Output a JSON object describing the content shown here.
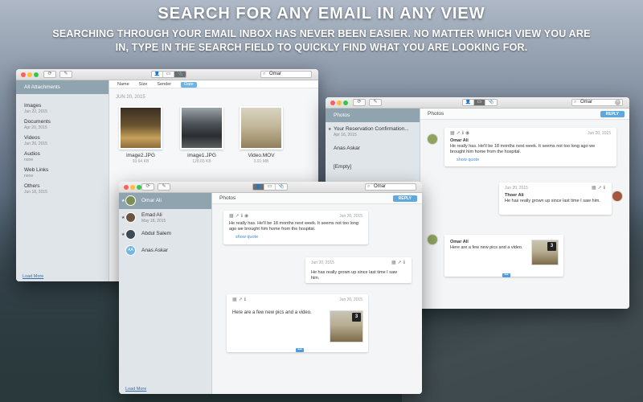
{
  "promo": {
    "headline": "SEARCH FOR ANY EMAIL IN ANY VIEW",
    "subline": "SEARCHING THROUGH YOUR EMAIL INBOX HAS NEVER BEEN EASIER. NO MATTER WHICH VIEW YOU ARE IN, TYPE IN THE SEARCH FIELD TO QUICKLY FIND WHAT YOU ARE LOOKING FOR."
  },
  "search_query": "Omar",
  "attachments_window": {
    "sidebar": {
      "items": [
        {
          "label": "All Attachments",
          "sub": ""
        },
        {
          "label": "Images",
          "sub": "Jun 22, 2015"
        },
        {
          "label": "Documents",
          "sub": "Apr 20, 2015"
        },
        {
          "label": "Videos",
          "sub": "Jun 20, 2015"
        },
        {
          "label": "Audios",
          "sub": "none"
        },
        {
          "label": "Web Links",
          "sub": "none"
        },
        {
          "label": "Others",
          "sub": "Jun 18, 2015"
        }
      ],
      "load_more": "Load More"
    },
    "sort": [
      "Name",
      "Size",
      "Sender",
      "Date"
    ],
    "section_date": "JUN 20, 2015",
    "files": [
      {
        "name": "image2.JPG",
        "size": "93.64 KB"
      },
      {
        "name": "image1.JPG",
        "size": "128.65 KB"
      },
      {
        "name": "Video.MOV",
        "size": "3.91 MB"
      }
    ]
  },
  "conversation_window": {
    "sidebar": {
      "items": [
        {
          "label": "Photos",
          "sub": ""
        },
        {
          "label": "Your Reservation Confirmation...",
          "sub": "Apr 16, 2015"
        },
        {
          "label": "Anas Askar",
          "sub": ""
        },
        {
          "label": "[Empty]",
          "sub": ""
        }
      ]
    },
    "pane_title": "Photos",
    "reply_label": "REPLY",
    "messages": [
      {
        "date": "Jun 20, 2015",
        "from": "Omar Ali",
        "text": "He really has. He'll be 18 months next week. It seems not too long ago we brought him home from the hospital.",
        "link": "show quote"
      },
      {
        "date": "Jun 20, 2015",
        "from": "Thoer Ali",
        "text": "He has really grown up since last time I saw him."
      },
      {
        "from": "Omar Ali",
        "text": "Here are a few new pics and a video.",
        "badge": "3"
      }
    ]
  },
  "contacts_window": {
    "sidebar": {
      "items": [
        {
          "label": "Omar Ali",
          "sub": ""
        },
        {
          "label": "Emad Ali",
          "sub": "May 18, 2015"
        },
        {
          "label": "Abdul Salem",
          "sub": ""
        },
        {
          "label": "Anas Askar",
          "sub": ""
        }
      ],
      "anas_initials": "AA",
      "load_more": "Load More"
    },
    "pane_title": "Photos",
    "reply_label": "REPLY",
    "messages": [
      {
        "date": "Jun 20, 2015",
        "text": "He really has. He'll be 18 months next week. It seems not too long ago we brought him home from the hospital.",
        "link": "show quote"
      },
      {
        "date": "Jun 20, 2015",
        "text": "He has really grown up since last time I saw him."
      },
      {
        "date": "Jun 20, 2015",
        "text": "Here are a few new pics and a video.",
        "badge": "3"
      }
    ],
    "more_label": "•••"
  }
}
